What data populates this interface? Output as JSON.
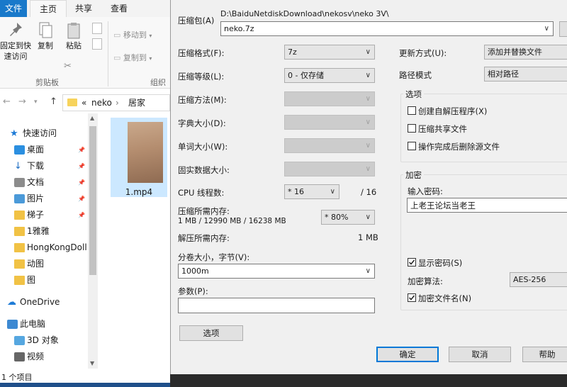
{
  "explorer": {
    "tabs": {
      "file": "文件",
      "home": "主页",
      "share": "共享",
      "view": "查看"
    },
    "ribbon": {
      "pin_label": "固定到快\n速访问",
      "copy_label": "复制",
      "paste_label": "粘贴",
      "move_to_label": "移动到",
      "copy_to_label": "复制到",
      "clipboard_group": "剪贴板",
      "organize_group": "组织"
    },
    "address": {
      "prefix": "«",
      "part1": "neko",
      "sep": "›",
      "part2": "居家"
    },
    "tree": [
      {
        "label": "快速访问",
        "icon": "star-icon",
        "pinned": false
      },
      {
        "label": "桌面",
        "icon": "desktop-icon",
        "pinned": true
      },
      {
        "label": "下载",
        "icon": "download-icon",
        "pinned": true
      },
      {
        "label": "文档",
        "icon": "document-icon",
        "pinned": true
      },
      {
        "label": "图片",
        "icon": "picture-icon",
        "pinned": true
      },
      {
        "label": "梯子",
        "icon": "folder-icon",
        "pinned": true
      },
      {
        "label": "1雅雅",
        "icon": "folder-icon",
        "pinned": false
      },
      {
        "label": "HongKongDoll",
        "icon": "folder-icon",
        "pinned": false
      },
      {
        "label": "动图",
        "icon": "folder-icon",
        "pinned": false
      },
      {
        "label": "图",
        "icon": "folder-icon",
        "pinned": false
      },
      {
        "label": "OneDrive",
        "icon": "cloud-icon",
        "pinned": false
      },
      {
        "label": "此电脑",
        "icon": "computer-icon",
        "pinned": false
      },
      {
        "label": "3D 对象",
        "icon": "cube-icon",
        "pinned": false
      },
      {
        "label": "视频",
        "icon": "video-icon",
        "pinned": false
      }
    ],
    "file": {
      "name": "1.mp4"
    },
    "status": "1 个项目"
  },
  "dialog": {
    "archive_label": "压缩包(A)",
    "archive_path": "D:\\BaiduNetdiskDownload\\nekosv\\neko 3V\\",
    "archive_name": "neko.7z",
    "format_label": "压缩格式(F):",
    "format_value": "7z",
    "level_label": "压缩等级(L):",
    "level_value": "0 - 仅存储",
    "method_label": "压缩方法(M):",
    "dict_label": "字典大小(D):",
    "word_label": "单词大小(W):",
    "solid_label": "固实数据大小:",
    "threads_label": "CPU 线程数:",
    "threads_value": "* 16",
    "threads_total": "/ 16",
    "mem_comp_label": "压缩所需内存:",
    "mem_comp_value": "1 MB / 12990 MB / 16238 MB",
    "mem_pct": "* 80%",
    "mem_decomp_label": "解压所需内存:",
    "mem_decomp_value": "1 MB",
    "split_label": "分卷大小，字节(V):",
    "split_value": "1000m",
    "params_label": "参数(P):",
    "params_value": "",
    "options_button": "选项",
    "update_label": "更新方式(U):",
    "update_value": "添加并替换文件",
    "path_label": "路径模式",
    "path_value": "相对路径",
    "options_group": "选项",
    "opt_sfx": "创建自解压程序(X)",
    "opt_shared": "压缩共享文件",
    "opt_delete": "操作完成后删除源文件",
    "enc_group": "加密",
    "pwd_label": "输入密码:",
    "pwd_value": "上老王论坛当老王",
    "show_pwd": "显示密码(S)",
    "enc_method_label": "加密算法:",
    "enc_method_value": "AES-256",
    "enc_names": "加密文件名(N)",
    "ok": "确定",
    "cancel": "取消",
    "help": "帮助"
  }
}
